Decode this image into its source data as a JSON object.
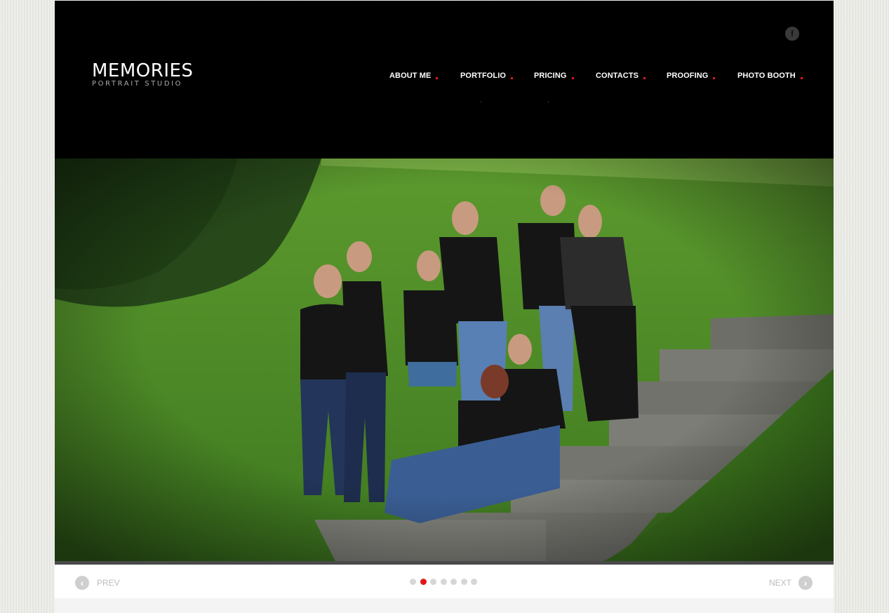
{
  "logo": {
    "title": "MEMORIES",
    "subtitle": "PORTRAIT STUDIO"
  },
  "social": {
    "facebook_glyph": "f"
  },
  "nav": {
    "items": [
      {
        "label": "ABOUT ME"
      },
      {
        "label": "PORTFOLIO"
      },
      {
        "label": "PRICING"
      },
      {
        "label": "CONTACTS"
      },
      {
        "label": "PROOFING"
      },
      {
        "label": "PHOTO BOOTH"
      }
    ]
  },
  "slider": {
    "prev_label": "PREV",
    "next_label": "NEXT",
    "prev_icon": "chevron-left-icon",
    "next_icon": "chevron-right-icon",
    "slide_count": 7,
    "active_index": 1
  },
  "colors": {
    "accent": "#e3161b",
    "header_bg": "#000000",
    "page_bg": "#e9e9e4"
  }
}
